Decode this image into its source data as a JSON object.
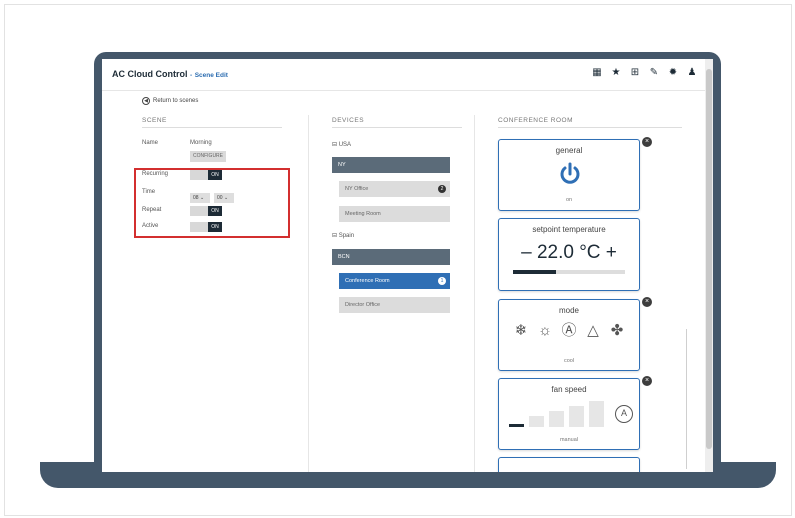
{
  "app": {
    "title": "AC Cloud Control",
    "separator": "-",
    "subtitle": "Scene Edit"
  },
  "toolbar": {
    "icons": [
      "dashboard-icon",
      "star-icon",
      "calendar-grid-icon",
      "wrench-icon",
      "gear-icon",
      "user-icon"
    ]
  },
  "back": {
    "label": "Return to scenes"
  },
  "columns": {
    "scene": "SCENE",
    "devices": "DEVICES",
    "room": "CONFERENCE ROOM"
  },
  "scene": {
    "name_label": "Name",
    "name_value": "Morning",
    "config_button": "CONFIGURE",
    "recurring_label": "Recurring",
    "time_label": "Time",
    "hour_value": "08",
    "minute_value": "00",
    "repeat_label": "Repeat",
    "active_label": "Active",
    "toggle_on": "ON"
  },
  "devices": {
    "group1_title": "USA",
    "group1_bar": "NY",
    "group1_items": [
      {
        "label": "NY Office",
        "badge": "2"
      },
      {
        "label": "Meeting Room",
        "badge": ""
      }
    ],
    "group2_title": "Spain",
    "group2_bar": "BCN",
    "group2_items": [
      {
        "label": "Conference Room",
        "badge": "1",
        "active": true
      },
      {
        "label": "Director Office",
        "badge": ""
      }
    ]
  },
  "room": {
    "general": {
      "title": "general",
      "foot": "on"
    },
    "setpoint": {
      "title": "setpoint temperature",
      "minus": "–",
      "value": "22.0 °C",
      "plus": "+",
      "level": 0.38
    },
    "mode": {
      "title": "mode",
      "icons": [
        "snowflake-icon",
        "sun-icon",
        "auto-icon",
        "drop-icon",
        "fan-icon"
      ],
      "foot": "cool"
    },
    "fan": {
      "title": "fan speed",
      "auto": "A",
      "foot": "manual",
      "level": 1,
      "levels": 5
    }
  },
  "colors": {
    "laptop": "#44576a",
    "accent": "#2f6fb5",
    "dark": "#1d2b36",
    "highlight": "#d32f2f"
  }
}
